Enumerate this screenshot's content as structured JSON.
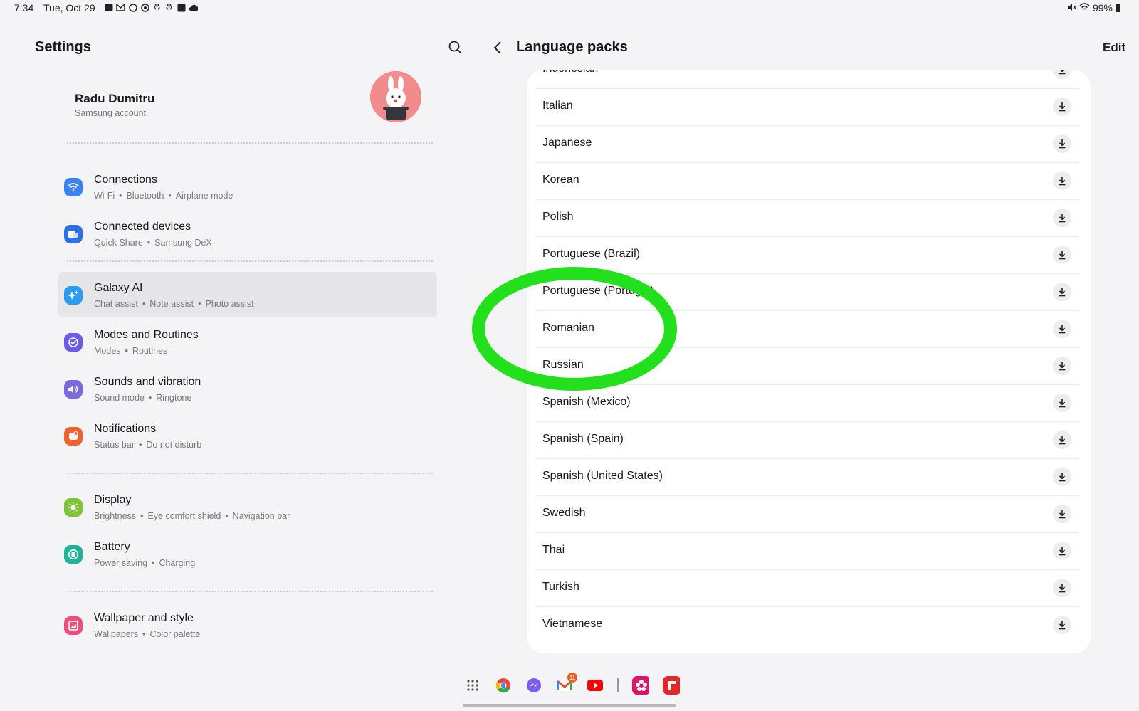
{
  "status_bar": {
    "time": "7:34",
    "date": "Tue, Oct 29",
    "notification_icons": [
      "message-icon",
      "gmail-icon",
      "threads-icon",
      "record-icon",
      "settings-icon",
      "settings-icon",
      "gallery-icon",
      "cloud-icon"
    ],
    "battery": "99%"
  },
  "left_pane": {
    "title": "Settings",
    "profile": {
      "name": "Radu Dumitru",
      "subtitle": "Samsung account"
    },
    "items": [
      {
        "title": "Connections",
        "sub": [
          "Wi-Fi",
          "Bluetooth",
          "Airplane mode"
        ],
        "icon": "wifi-icon",
        "color": "#3b82f6"
      },
      {
        "title": "Connected devices",
        "sub": [
          "Quick Share",
          "Samsung DeX"
        ],
        "icon": "devices-icon",
        "color": "#2f6fe4"
      },
      {
        "title": "Galaxy AI",
        "sub": [
          "Chat assist",
          "Note assist",
          "Photo assist"
        ],
        "icon": "sparkle-icon",
        "color": "#2d9cf0",
        "selected": true
      },
      {
        "title": "Modes and Routines",
        "sub": [
          "Modes",
          "Routines"
        ],
        "icon": "check-circle-icon",
        "color": "#6b5ce7"
      },
      {
        "title": "Sounds and vibration",
        "sub": [
          "Sound mode",
          "Ringtone"
        ],
        "icon": "speaker-icon",
        "color": "#7a6ae0"
      },
      {
        "title": "Notifications",
        "sub": [
          "Status bar",
          "Do not disturb"
        ],
        "icon": "bell-icon",
        "color": "#f0612d"
      },
      {
        "title": "Display",
        "sub": [
          "Brightness",
          "Eye comfort shield",
          "Navigation bar"
        ],
        "icon": "sun-icon",
        "color": "#7cc43a"
      },
      {
        "title": "Battery",
        "sub": [
          "Power saving",
          "Charging"
        ],
        "icon": "battery-icon",
        "color": "#1fb39a"
      },
      {
        "title": "Wallpaper and style",
        "sub": [
          "Wallpapers",
          "Color palette"
        ],
        "icon": "wallpaper-icon",
        "color": "#ec4f7a"
      }
    ]
  },
  "right_pane": {
    "title": "Language packs",
    "edit_label": "Edit",
    "languages": [
      "Indonesian",
      "Italian",
      "Japanese",
      "Korean",
      "Polish",
      "Portuguese (Brazil)",
      "Portuguese (Portugal)",
      "Romanian",
      "Russian",
      "Spanish (Mexico)",
      "Spanish (Spain)",
      "Spanish (United States)",
      "Swedish",
      "Thai",
      "Turkish",
      "Vietnamese"
    ]
  },
  "dock": {
    "apps": [
      "app-drawer-icon",
      "chrome-icon",
      "messenger-icon",
      "gmail-icon",
      "youtube-icon",
      "blossom-app-icon",
      "flipboard-icon"
    ],
    "gmail_badge": "11"
  },
  "colors": {
    "highlight": "#22e01c",
    "background": "#f4f4f6",
    "card": "#ffffff"
  }
}
